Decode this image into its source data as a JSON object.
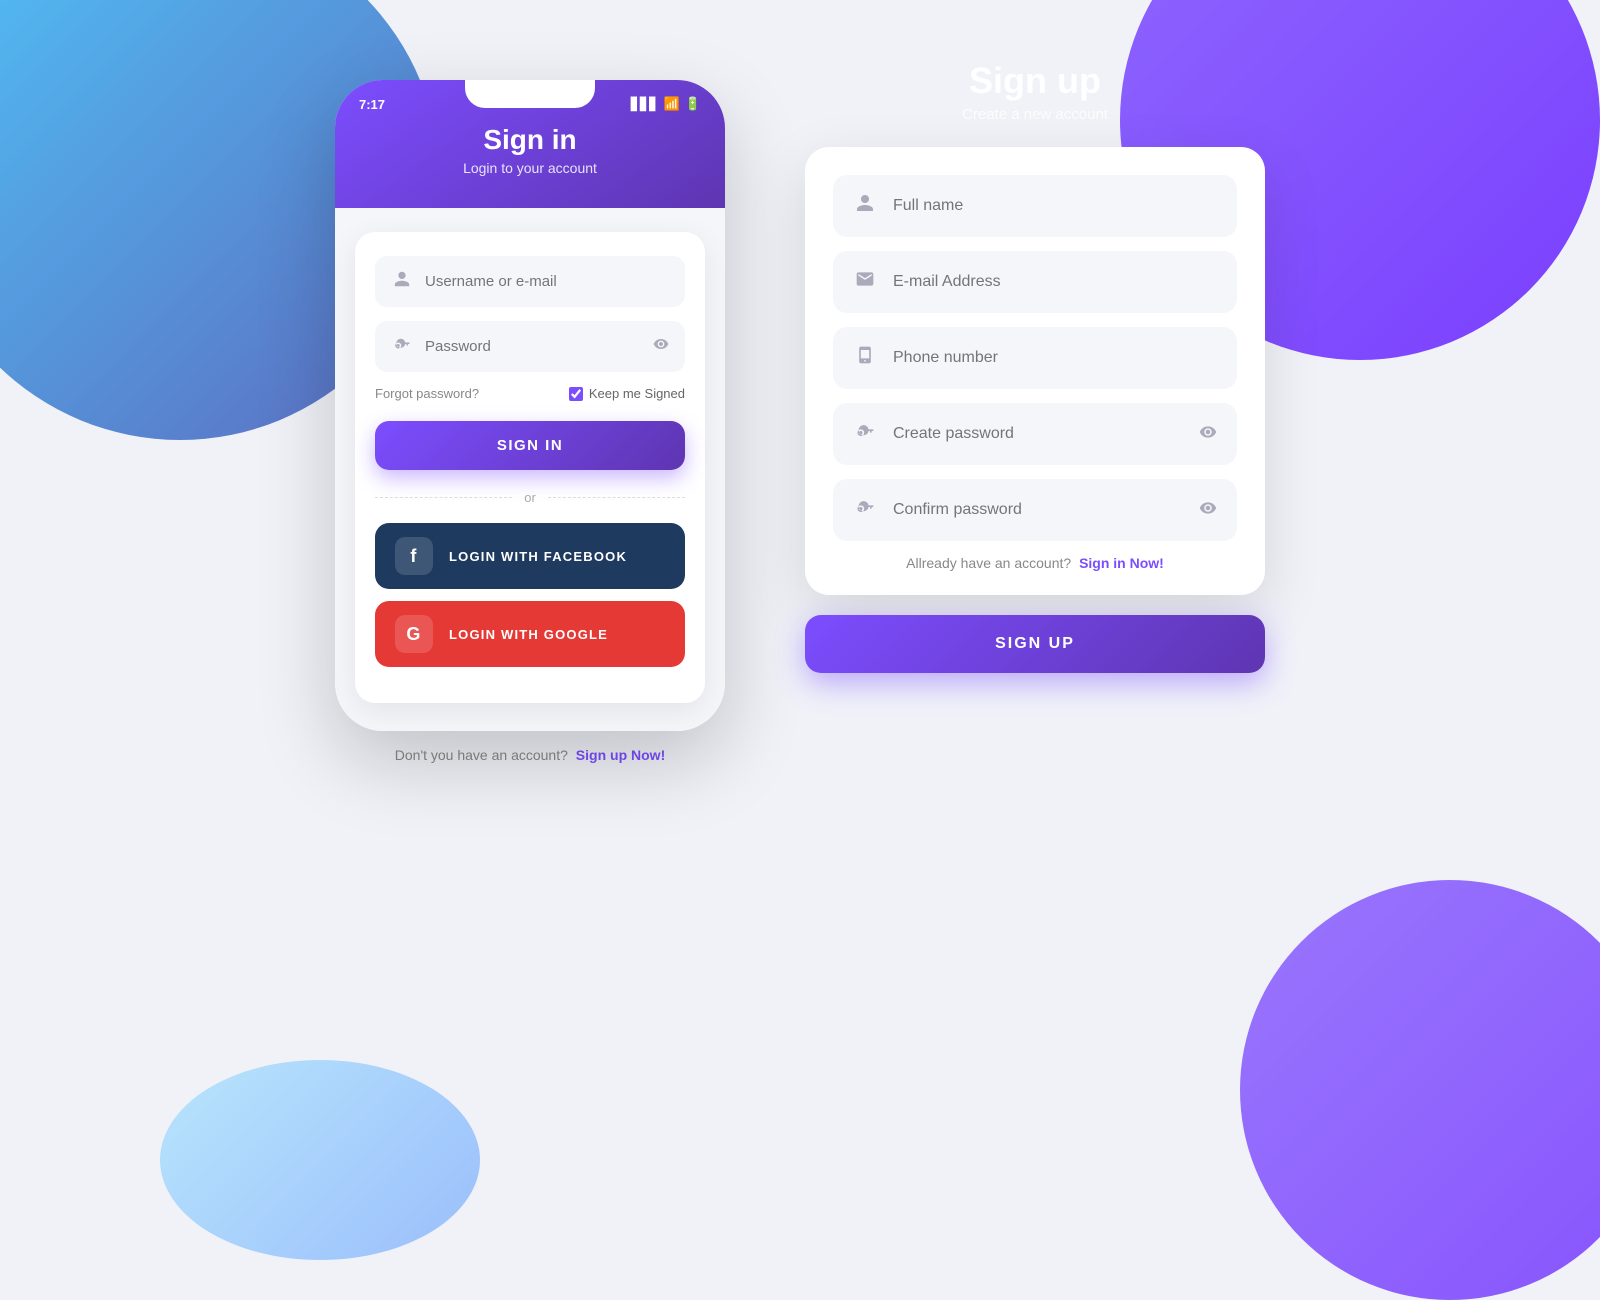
{
  "background": {
    "color": "#f0f2f8"
  },
  "signin": {
    "status_time": "7:17",
    "title": "Sign in",
    "subtitle": "Login to your account",
    "username_placeholder": "Username or e-mail",
    "password_placeholder": "Password",
    "forgot_password": "Forgot password?",
    "keep_signed": "Keep me Signed",
    "sign_in_button": "SIGN IN",
    "divider_text": "or",
    "facebook_button": "LOGIN WITH FACEBOOK",
    "google_button": "LOGIN WITH GOOGLE",
    "footer_text": "Don't you have an account?",
    "footer_link": "Sign up Now!"
  },
  "signup": {
    "title": "Sign up",
    "subtitle": "Create a new account",
    "fullname_placeholder": "Full name",
    "email_placeholder": "E-mail Address",
    "phone_placeholder": "Phone number",
    "password_placeholder": "Create password",
    "confirm_placeholder": "Confirm password",
    "already_text": "Allready have an account?",
    "already_link": "Sign in Now!",
    "sign_up_button": "SIGN UP"
  },
  "icons": {
    "user": "👤",
    "email": "✉",
    "phone": "📱",
    "key": "🔑",
    "eye": "👁",
    "facebook": "f",
    "google": "G",
    "checkbox": "☑"
  },
  "colors": {
    "purple": "#7c4dff",
    "purple_dark": "#5e35b1",
    "facebook_blue": "#1e3a5f",
    "google_red": "#e53935",
    "accent_link": "#7c4dff"
  }
}
